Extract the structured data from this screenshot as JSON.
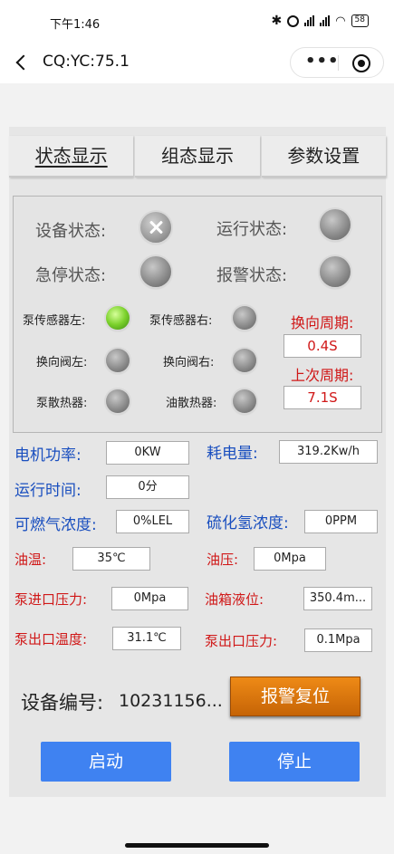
{
  "statusbar": {
    "time": "下午1:46",
    "battery": "58"
  },
  "navbar": {
    "title": "CQ:YC:75.1"
  },
  "tabs": [
    "状态显示",
    "组态显示",
    "参数设置"
  ],
  "status": {
    "device_status": "设备状态:",
    "run_status": "运行状态:",
    "estop_status": "急停状态:",
    "alarm_status": "报警状态:",
    "pump_sensor_left": "泵传感器左:",
    "pump_sensor_right": "泵传感器右:",
    "reversing_valve_left": "换向阀左:",
    "reversing_valve_right": "换向阀右:",
    "pump_radiator": "泵散热器:",
    "oil_radiator": "油散热器:",
    "reverse_period_label": "换向周期:",
    "reverse_period_value": "0.4S",
    "last_period_label": "上次周期:",
    "last_period_value": "7.1S"
  },
  "metrics": {
    "motor_power_label": "电机功率:",
    "motor_power_value": "0KW",
    "energy_label": "耗电量:",
    "energy_value": "319.2Kw/h",
    "runtime_label": "运行时间:",
    "runtime_value": "0分",
    "combustible_label": "可燃气浓度:",
    "combustible_value": "0%LEL",
    "h2s_label": "硫化氢浓度:",
    "h2s_value": "0PPM",
    "oil_temp_label": "油温:",
    "oil_temp_value": "35℃",
    "oil_pressure_label": "油压:",
    "oil_pressure_value": "0Mpa",
    "pump_inlet_pressure_label": "泵进口压力:",
    "pump_inlet_pressure_value": "0Mpa",
    "tank_level_label": "油箱液位:",
    "tank_level_value": "350.4m...",
    "pump_outlet_temp_label": "泵出口温度:",
    "pump_outlet_temp_value": "31.1℃",
    "pump_outlet_pressure_label": "泵出口压力:",
    "pump_outlet_pressure_value": "0.1Mpa"
  },
  "device": {
    "number_label": "设备编号:",
    "number_value": "10231156..."
  },
  "buttons": {
    "alarm_reset": "报警复位",
    "start": "启动",
    "stop": "停止"
  }
}
